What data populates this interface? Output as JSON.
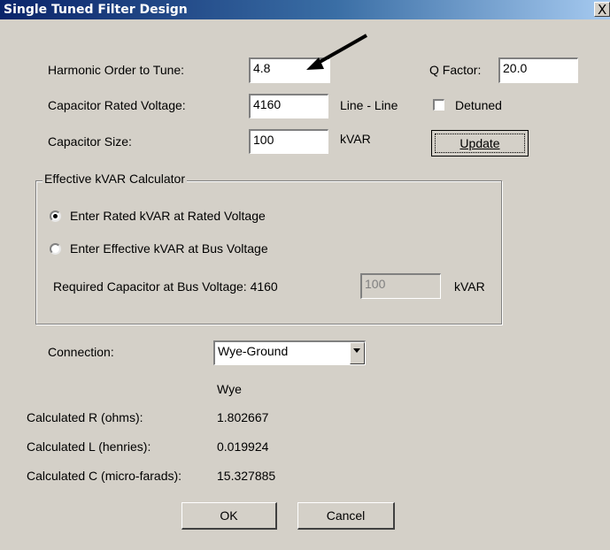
{
  "window": {
    "title": "Single Tuned Filter Design",
    "close_glyph": "X"
  },
  "harmonic": {
    "label": "Harmonic Order to Tune:",
    "value": "4.8"
  },
  "q_factor": {
    "label": "Q Factor:",
    "value": "20.0"
  },
  "cap_voltage": {
    "label": "Capacitor Rated Voltage:",
    "value": "4160",
    "unit": "Line - Line"
  },
  "detuned": {
    "label": "Detuned",
    "checked": false
  },
  "cap_size": {
    "label": "Capacitor Size:",
    "value": "100",
    "unit": "kVAR"
  },
  "update_button": "Update",
  "calculator": {
    "title": "Effective kVAR Calculator",
    "option_rated": "Enter Rated kVAR at Rated Voltage",
    "option_effective": "Enter Effective kVAR at Bus Voltage",
    "selected": "rated",
    "required_label": "Required Capacitor at Bus Voltage: 4160",
    "required_value": "100",
    "required_unit": "kVAR"
  },
  "connection": {
    "label": "Connection:",
    "value": "Wye-Ground",
    "sub_label": "Wye"
  },
  "results": {
    "r_label": "Calculated R (ohms):",
    "r_value": "1.802667",
    "l_label": "Calculated L (henries):",
    "l_value": "0.019924",
    "c_label": "Calculated C (micro-farads):",
    "c_value": "15.327885"
  },
  "ok_button": "OK",
  "cancel_button": "Cancel",
  "colors": {
    "titlebar_start": "#0a246a",
    "titlebar_end": "#a6caf0",
    "dialog_bg": "#d4d0c8"
  },
  "icons": {
    "annotation": "arrow-pointer-icon",
    "dropdown": "chevron-down-icon"
  }
}
